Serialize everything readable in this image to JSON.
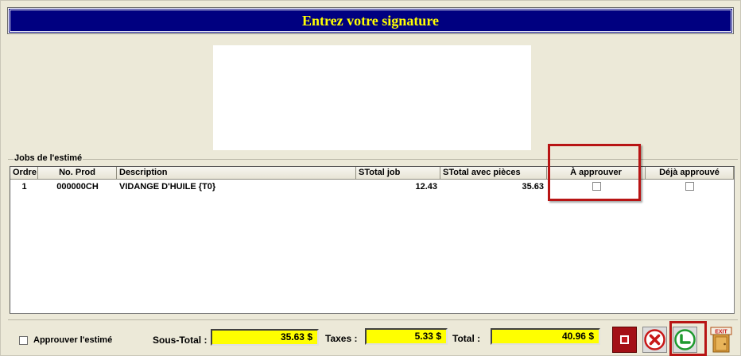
{
  "window": {
    "title": "Entrez votre signature"
  },
  "jobs_group": {
    "label": "Jobs de l'estimé"
  },
  "grid": {
    "columns": [
      "Ordre",
      "No. Prod",
      "Description",
      "STotal job",
      "STotal avec pièces",
      "À approuver",
      "Déjà approuvé"
    ],
    "rows": [
      {
        "ordre": "1",
        "no_prod": "000000CH",
        "description": "VIDANGE D'HUILE {T0}",
        "stotal_job": "12.43",
        "stotal_pieces": "35.63",
        "a_approuver": false,
        "deja_approuve": false
      }
    ]
  },
  "footer": {
    "approve_label": "Approuver l'estimé",
    "approve_checked": false,
    "sous_total_label": "Sous-Total :",
    "sous_total_value": "35.63 $",
    "taxes_label": "Taxes :",
    "taxes_value": "5.33 $",
    "total_label": "Total :",
    "total_value": "40.96 $"
  },
  "buttons": {
    "stop": "stop-icon",
    "cancel": "cancel-x-icon",
    "ok": "check-ok-icon",
    "exit": "exit-door-icon",
    "exit_sign": "EXIT"
  },
  "colors": {
    "title_bg": "#000080",
    "title_text": "#ffff00",
    "amount_bg": "#ffff00",
    "highlight": "#b81414"
  }
}
